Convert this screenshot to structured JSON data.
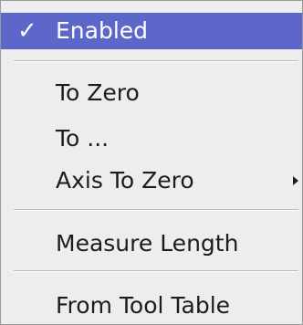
{
  "menu": {
    "items": [
      {
        "label": "Enabled",
        "checked": true,
        "highlighted": true
      },
      {
        "label": "To Zero"
      },
      {
        "label": "To ..."
      },
      {
        "label": "Axis To Zero",
        "has_submenu": true
      },
      {
        "label": "Measure Length"
      },
      {
        "label": "From Tool Table"
      }
    ],
    "check_mark": "✓",
    "colors": {
      "highlight": "#5d67c9",
      "background": "#ededed",
      "text": "#1c1c1c",
      "highlight_text": "#ffffff"
    }
  }
}
